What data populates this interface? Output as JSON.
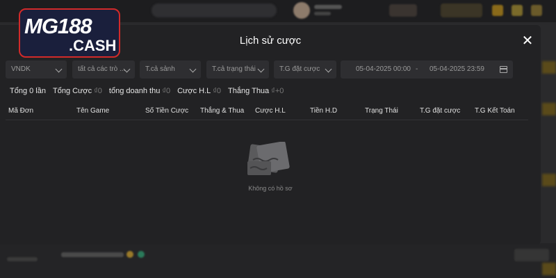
{
  "logo": {
    "top": "MG188",
    "bottom": ".CASH"
  },
  "modal": {
    "title": "Lịch sử cược",
    "close_label": "✕"
  },
  "filters": {
    "currency": "VNDK",
    "game": "tất cả các trò ...",
    "lobby": "T.cả sảnh",
    "status": "T.cả trạng thái",
    "bet_time": "T.G đặt cược",
    "date_start": "05-04-2025 00:00",
    "date_sep": "-",
    "date_end": "05-04-2025 23:59"
  },
  "summary": {
    "total_label": "Tổng 0 lần",
    "bet_label": "Tổng Cược",
    "bet_value": "₫0",
    "revenue_label": "tổng doanh thu",
    "revenue_value": "₫0",
    "valid_label": "Cược H.L",
    "valid_value": "₫0",
    "winlose_label": "Thắng Thua",
    "winlose_value": "₫+0"
  },
  "table": {
    "columns": [
      "Mã Đơn",
      "Tên Game",
      "Số Tiền Cược",
      "Thắng & Thua",
      "Cược H.L",
      "Tiền H.D",
      "Trạng Thái",
      "T.G đặt cược",
      "T.G Kết Toán"
    ]
  },
  "empty": {
    "text": "Không có hồ sơ"
  },
  "colors": {
    "accent": "#d22a2a",
    "modal_bg": "#222224",
    "field_bg": "#2e2e31"
  }
}
